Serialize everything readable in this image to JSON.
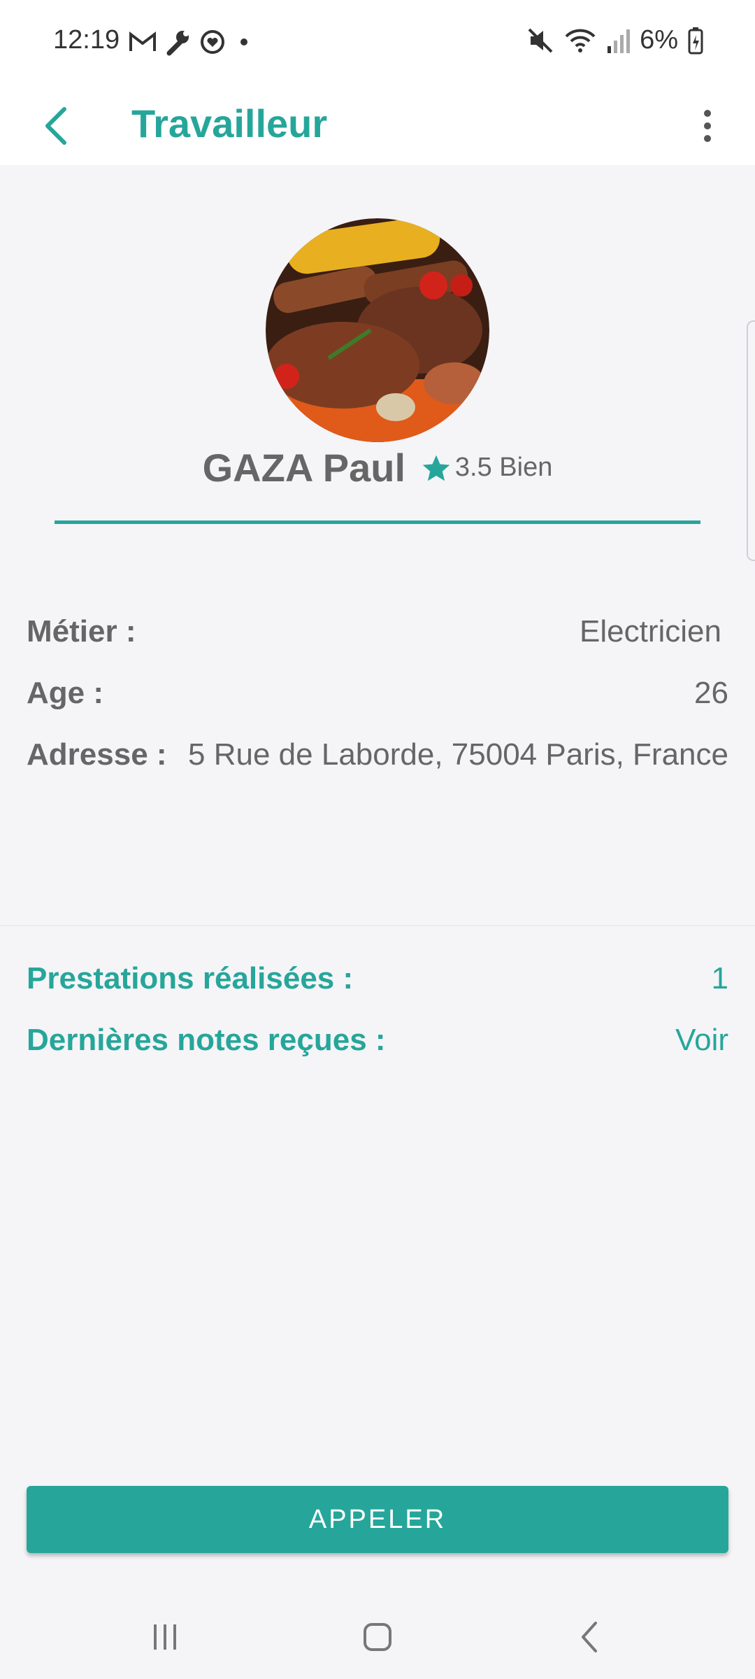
{
  "status_bar": {
    "time": "12:19",
    "battery": "6%",
    "left_icons": [
      "gmail-icon",
      "wrench-icon",
      "health-icon",
      "dot-icon"
    ],
    "right_icons": [
      "mute-icon",
      "wifi-icon",
      "signal-icon",
      "battery-icon"
    ]
  },
  "app_bar": {
    "title": "Travailleur"
  },
  "profile": {
    "name": "GAZA Paul",
    "rating": "3.5 Bien"
  },
  "details": {
    "metier_label": "Métier :",
    "metier_value": "Electricien",
    "age_label": "Age :",
    "age_value": "26",
    "adresse_label": "Adresse :",
    "adresse_value": "5 Rue de Laborde, 75004 Paris, France"
  },
  "stats": {
    "prestations_label": "Prestations réalisées :",
    "prestations_value": "1",
    "notes_label": "Dernières notes reçues :",
    "notes_value": "Voir"
  },
  "actions": {
    "call_label": "APPELER"
  },
  "colors": {
    "accent": "#26a69a",
    "background": "#f5f4f7",
    "text": "#666666"
  }
}
